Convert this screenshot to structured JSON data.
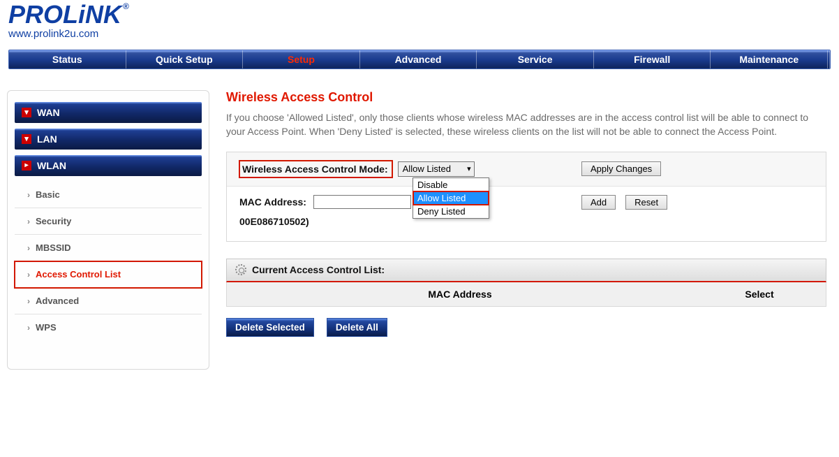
{
  "brand": {
    "logo": "PROLiNK",
    "reg": "®",
    "url": "www.prolink2u.com"
  },
  "topnav": {
    "items": [
      "Status",
      "Quick Setup",
      "Setup",
      "Advanced",
      "Service",
      "Firewall",
      "Maintenance"
    ],
    "active_index": 2
  },
  "sidebar": {
    "groups": [
      {
        "label": "WAN",
        "expanded": false
      },
      {
        "label": "LAN",
        "expanded": false
      },
      {
        "label": "WLAN",
        "expanded": true
      }
    ],
    "wlan_items": [
      "Basic",
      "Security",
      "MBSSID",
      "Access Control List",
      "Advanced",
      "WPS"
    ],
    "wlan_active_index": 3
  },
  "content": {
    "title": "Wireless Access Control",
    "desc": "If you choose 'Allowed Listed', only those clients whose wireless MAC addresses are in the access control list will be able to connect to your Access Point. When 'Deny Listed' is selected, these wireless clients on the list will not be able to connect the Access Point.",
    "mode_label": "Wireless Access Control Mode:",
    "mode_selected": "Allow Listed",
    "mode_options": [
      "Disable",
      "Allow Listed",
      "Deny Listed"
    ],
    "apply_label": "Apply Changes",
    "mac_label": "MAC Address:",
    "mac_example": "00E086710502)",
    "mac_value": "",
    "mac_placeholder": "",
    "add_label": "Add",
    "reset_label": "Reset",
    "list_section_title": "Current Access Control List:",
    "list_col1": "MAC Address",
    "list_col2": "Select",
    "delete_selected": "Delete Selected",
    "delete_all": "Delete All"
  }
}
